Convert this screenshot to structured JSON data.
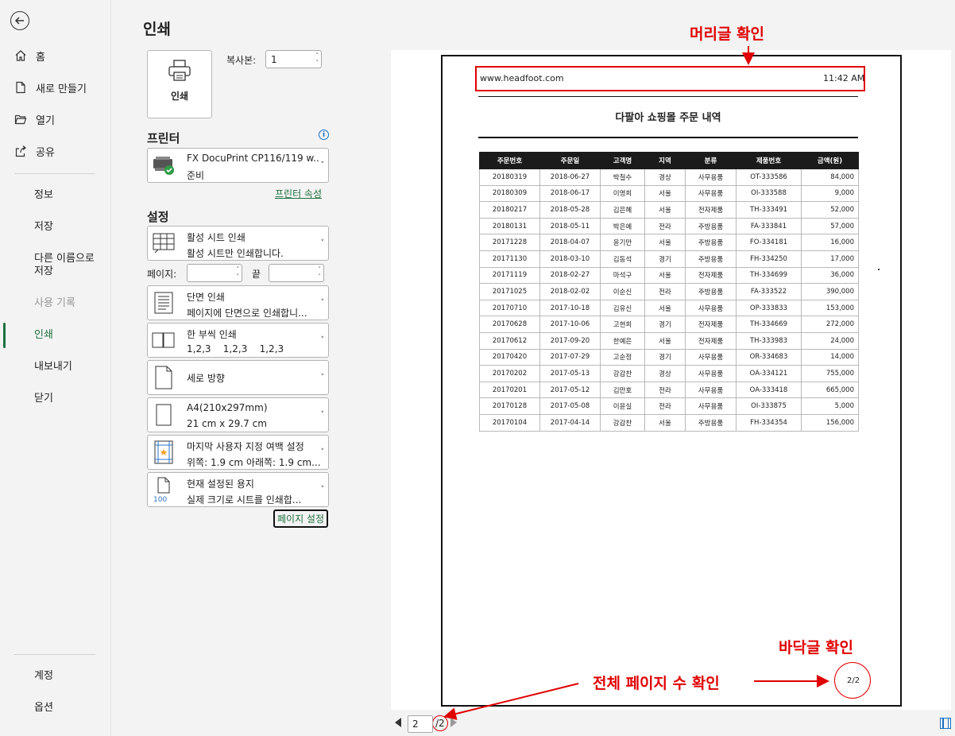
{
  "nav": {
    "items": [
      {
        "label": "홈",
        "icon": "home-icon"
      },
      {
        "label": "새로 만들기",
        "icon": "new-document-icon"
      },
      {
        "label": "열기",
        "icon": "folder-open-icon"
      },
      {
        "label": "공유",
        "icon": "share-icon"
      },
      {
        "label": "정보"
      },
      {
        "label": "저장"
      },
      {
        "label": "다른 이름으로 저장"
      },
      {
        "label": "사용 기록",
        "disabled": true
      },
      {
        "label": "인쇄",
        "active": true
      },
      {
        "label": "내보내기"
      },
      {
        "label": "닫기"
      },
      {
        "label": "계정"
      },
      {
        "label": "옵션"
      }
    ]
  },
  "print": {
    "title": "인쇄",
    "print_button": "인쇄",
    "copies_label": "복사본:",
    "copies_value": "1",
    "printer_section": "프린터",
    "printer": {
      "name": "FX DocuPrint CP116/119 w...",
      "status": "준비"
    },
    "printer_properties": "프린터 속성",
    "settings_section": "설정",
    "settings": [
      {
        "main": "활성 시트 인쇄",
        "sub": "활성 시트만 인쇄합니다."
      },
      {
        "main": "단면 인쇄",
        "sub": "페이지에 단면으로 인쇄합니..."
      },
      {
        "main": "한 부씩 인쇄",
        "sub": "1,2,3    1,2,3    1,2,3"
      },
      {
        "main": "세로 방향"
      },
      {
        "main": "A4(210x297mm)",
        "sub": "21 cm x 29.7 cm"
      },
      {
        "main": "마지막 사용자 지정 여백 설정",
        "sub": "위쪽: 1.9 cm 아래쪽: 1.9 cm..."
      },
      {
        "main": "현재 설정된 용지",
        "sub": "실제 크기로 시트를 인쇄합..."
      }
    ],
    "pages_label": "페이지:",
    "to_label": "끝",
    "page_setup": "페이지 설정",
    "scaling_badge": "100"
  },
  "preview": {
    "header_left": "www.headfoot.com",
    "header_right": "11:42 AM",
    "doc_title": "다팔아 쇼핑몰 주문 내역",
    "columns": [
      "주문번호",
      "주문일",
      "고객명",
      "지역",
      "분류",
      "제품번호",
      "금액(원)"
    ],
    "rows": [
      [
        "20180319",
        "2018-06-27",
        "박철수",
        "경상",
        "사무용품",
        "OT-333586",
        "84,000"
      ],
      [
        "20180309",
        "2018-06-17",
        "이영희",
        "서울",
        "사무용품",
        "OI-333588",
        "9,000"
      ],
      [
        "20180217",
        "2018-05-28",
        "김은혜",
        "서울",
        "전자제품",
        "TH-333491",
        "52,000"
      ],
      [
        "20180131",
        "2018-05-11",
        "박은예",
        "전라",
        "주방용품",
        "FA-333841",
        "57,000"
      ],
      [
        "20171228",
        "2018-04-07",
        "윤기만",
        "서울",
        "주방용품",
        "FO-334181",
        "16,000"
      ],
      [
        "20171130",
        "2018-03-10",
        "김동석",
        "경기",
        "주방용품",
        "FH-334250",
        "17,000"
      ],
      [
        "20171119",
        "2018-02-27",
        "마석구",
        "서울",
        "전자제품",
        "TH-334699",
        "36,000"
      ],
      [
        "20171025",
        "2018-02-02",
        "이순신",
        "전라",
        "주방용품",
        "FA-333522",
        "390,000"
      ],
      [
        "20170710",
        "2017-10-18",
        "김유신",
        "서울",
        "사무용품",
        "OP-333833",
        "153,000"
      ],
      [
        "20170628",
        "2017-10-06",
        "고현희",
        "경기",
        "전자제품",
        "TH-334669",
        "272,000"
      ],
      [
        "20170612",
        "2017-09-20",
        "한예은",
        "서울",
        "전자제품",
        "TH-333983",
        "24,000"
      ],
      [
        "20170420",
        "2017-07-29",
        "고순정",
        "경기",
        "사무용품",
        "OR-334683",
        "14,000"
      ],
      [
        "20170202",
        "2017-05-13",
        "강감찬",
        "경상",
        "사무용품",
        "OA-334121",
        "755,000"
      ],
      [
        "20170201",
        "2017-05-12",
        "김만호",
        "전라",
        "사무용품",
        "OA-333418",
        "665,000"
      ],
      [
        "20170128",
        "2017-05-08",
        "이윤실",
        "전라",
        "사무용품",
        "OI-333875",
        "5,000"
      ],
      [
        "20170104",
        "2017-04-14",
        "강감찬",
        "서울",
        "주방용품",
        "FH-334354",
        "156,000"
      ]
    ],
    "footer_page": "2/2",
    "current_page": "2",
    "total_pages": "/2"
  },
  "annotations": {
    "header_check": "머리글 확인",
    "footer_check": "바닥글 확인",
    "total_pages_check": "전체 페이지 수 확인",
    "color": "#e00000"
  },
  "colors": {
    "accent": "#1e6f3f",
    "info": "#1a6fc2"
  }
}
